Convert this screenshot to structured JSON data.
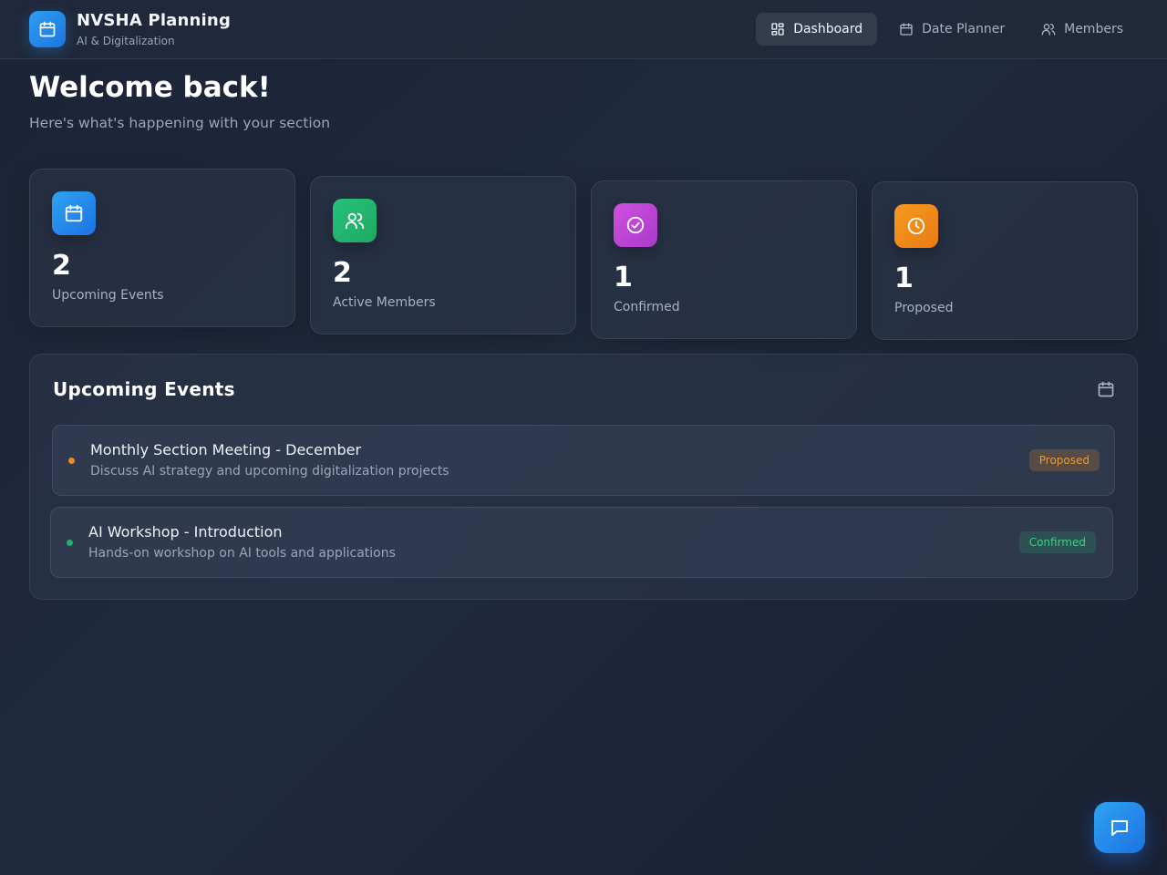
{
  "app": {
    "title": "NVSHA Planning",
    "subtitle": "AI & Digitalization",
    "logo_icon": "calendar-icon"
  },
  "nav": {
    "items": [
      {
        "label": "Dashboard",
        "icon": "grid-icon",
        "active": true
      },
      {
        "label": "Date Planner",
        "icon": "calendar-icon",
        "active": false
      },
      {
        "label": "Members",
        "icon": "users-icon",
        "active": false
      }
    ]
  },
  "welcome": {
    "title": "Welcome back!",
    "subtitle": "Here's what's happening with your section"
  },
  "stats": [
    {
      "value": "2",
      "label": "Upcoming Events",
      "icon": "calendar-icon",
      "color": "#2196f3"
    },
    {
      "value": "2",
      "label": "Active Members",
      "icon": "users-icon",
      "color": "#22b36b"
    },
    {
      "value": "1",
      "label": "Confirmed",
      "icon": "check-circle-icon",
      "color": "#c046d6"
    },
    {
      "value": "1",
      "label": "Proposed",
      "icon": "clock-icon",
      "color": "#f08a1c"
    }
  ],
  "events": {
    "title": "Upcoming Events",
    "icon": "calendar-icon",
    "items": [
      {
        "title": "Monthly Section Meeting - December",
        "description": "Discuss AI strategy and upcoming digitalization projects",
        "status": "Proposed",
        "status_color": "#f08a1c"
      },
      {
        "title": "AI Workshop - Introduction",
        "description": "Hands-on workshop on AI tools and applications",
        "status": "Confirmed",
        "status_color": "#22b36b"
      }
    ]
  },
  "chat": {
    "icon": "chat-icon"
  }
}
